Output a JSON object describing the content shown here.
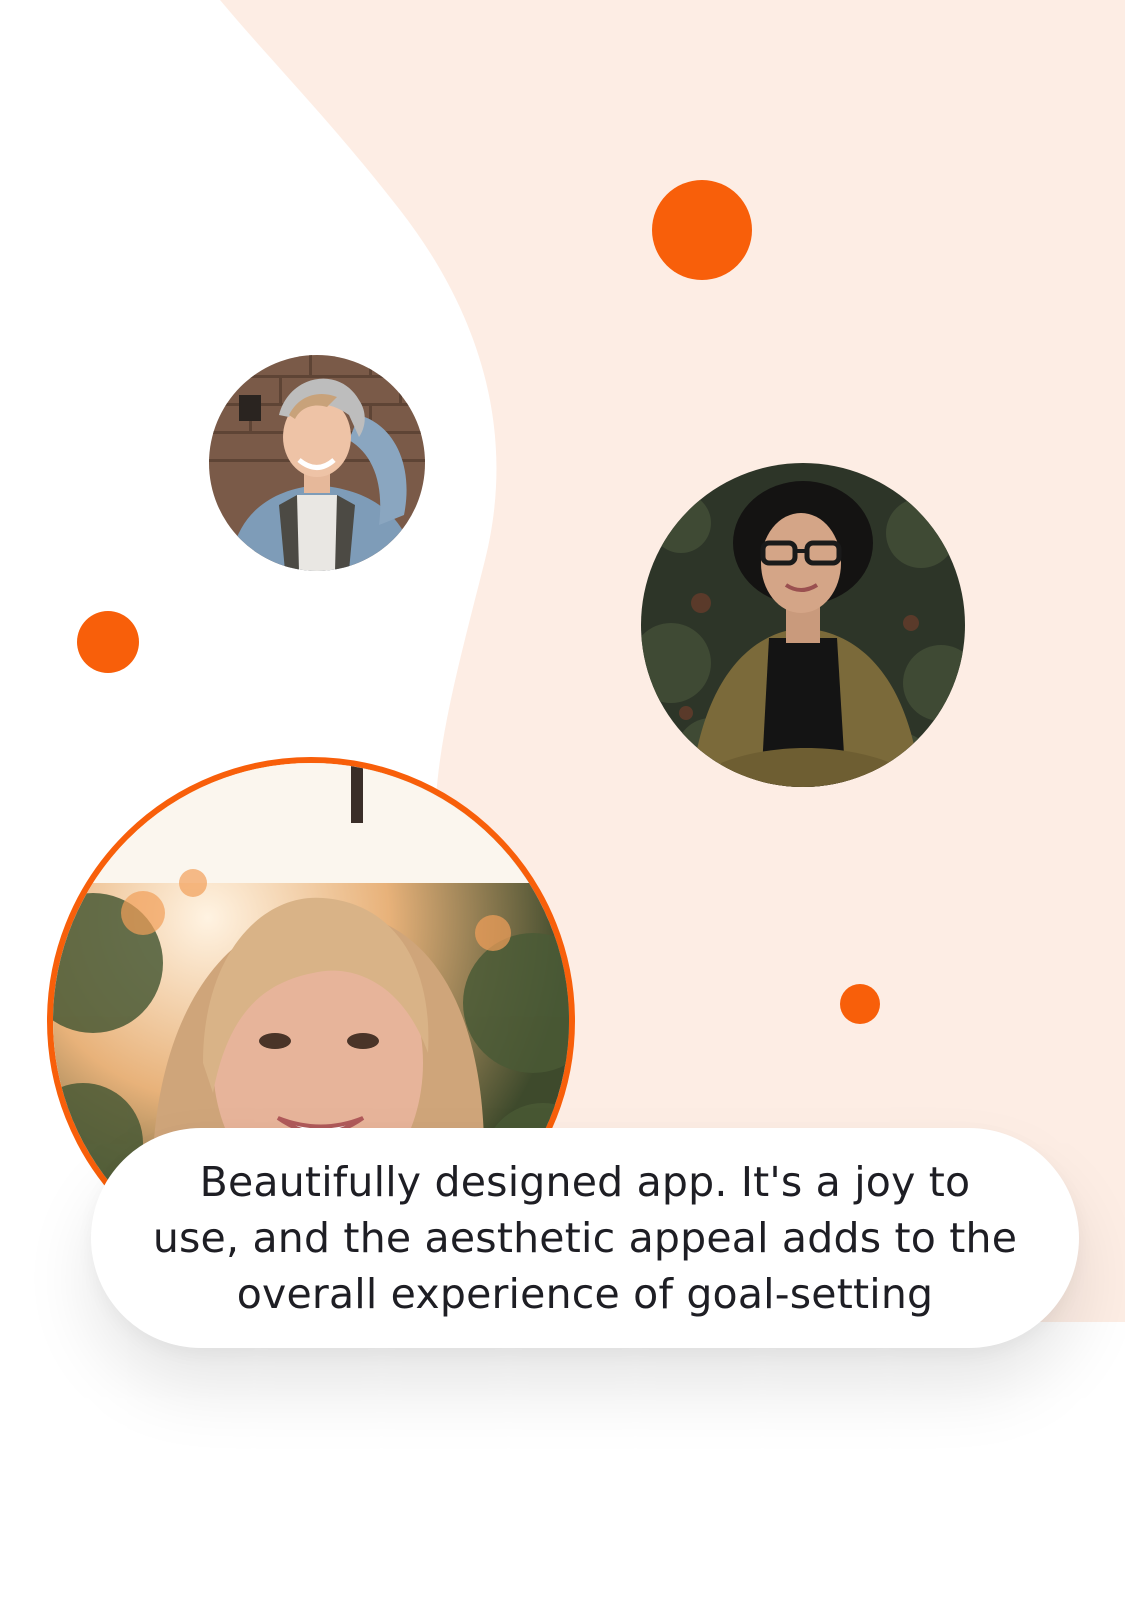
{
  "colors": {
    "accent": "#f85f0a",
    "peach_background": "#fdede4",
    "page_background": "#ffffff",
    "text": "#1e1e24"
  },
  "avatars": [
    {
      "name": "man-beanie-avatar",
      "icon": "person-photo"
    },
    {
      "name": "woman-glasses-avatar",
      "icon": "person-photo"
    },
    {
      "name": "featured-woman-avatar",
      "icon": "person-photo",
      "highlighted": true
    }
  ],
  "testimonial": {
    "quote": "Beautifully designed app. It's a joy to use, and the aesthetic appeal adds to the overall experience of goal-setting"
  }
}
